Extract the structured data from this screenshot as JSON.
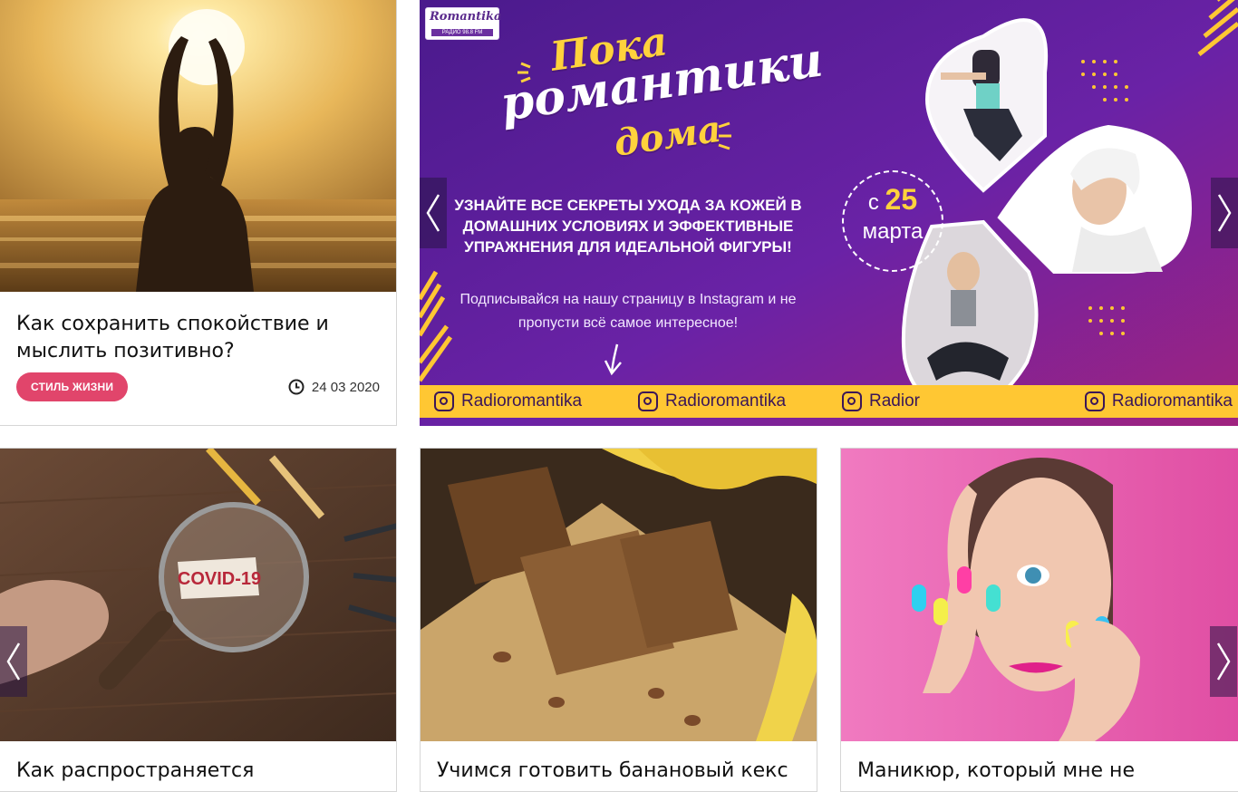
{
  "cards": [
    {
      "title": "Как сохранить спокойствие и мыслить позитивно?",
      "tag": "стиль жизни",
      "date": "24 03 2020",
      "image": "sunset-silhouette-photo"
    },
    {
      "title": "Как распространяется",
      "image": "covid-magnifier-photo",
      "image_text": "COVID-19"
    },
    {
      "title": "Учимся готовить банановый кекс",
      "image": "banana-bread-photo"
    },
    {
      "title": "Маникюр, который мне не",
      "image": "colorful-nails-photo"
    }
  ],
  "banner": {
    "logo_text": "Romantika",
    "logo_sub": "РАДИО 98.8 FM",
    "headline_1": "Пока",
    "headline_2": "романтики",
    "headline_3": "дома",
    "subtitle": "Узнайте все секреты ухода за кожей в домашних условиях и эффективные упражнения для идеальной фигуры!",
    "cta": "Подписывайся на нашу страницу в Instagram и не пропусти всё самое интересное!",
    "date_prefix": "с",
    "date_num": "25",
    "date_month": "марта",
    "instagram": [
      "Radioromantika",
      "Radioromantika",
      "Radior",
      "Radioromantika"
    ]
  },
  "colors": {
    "tag": "#e1456b",
    "banner_bg": "#5b1f9a",
    "banner_yellow": "#ffc733"
  }
}
